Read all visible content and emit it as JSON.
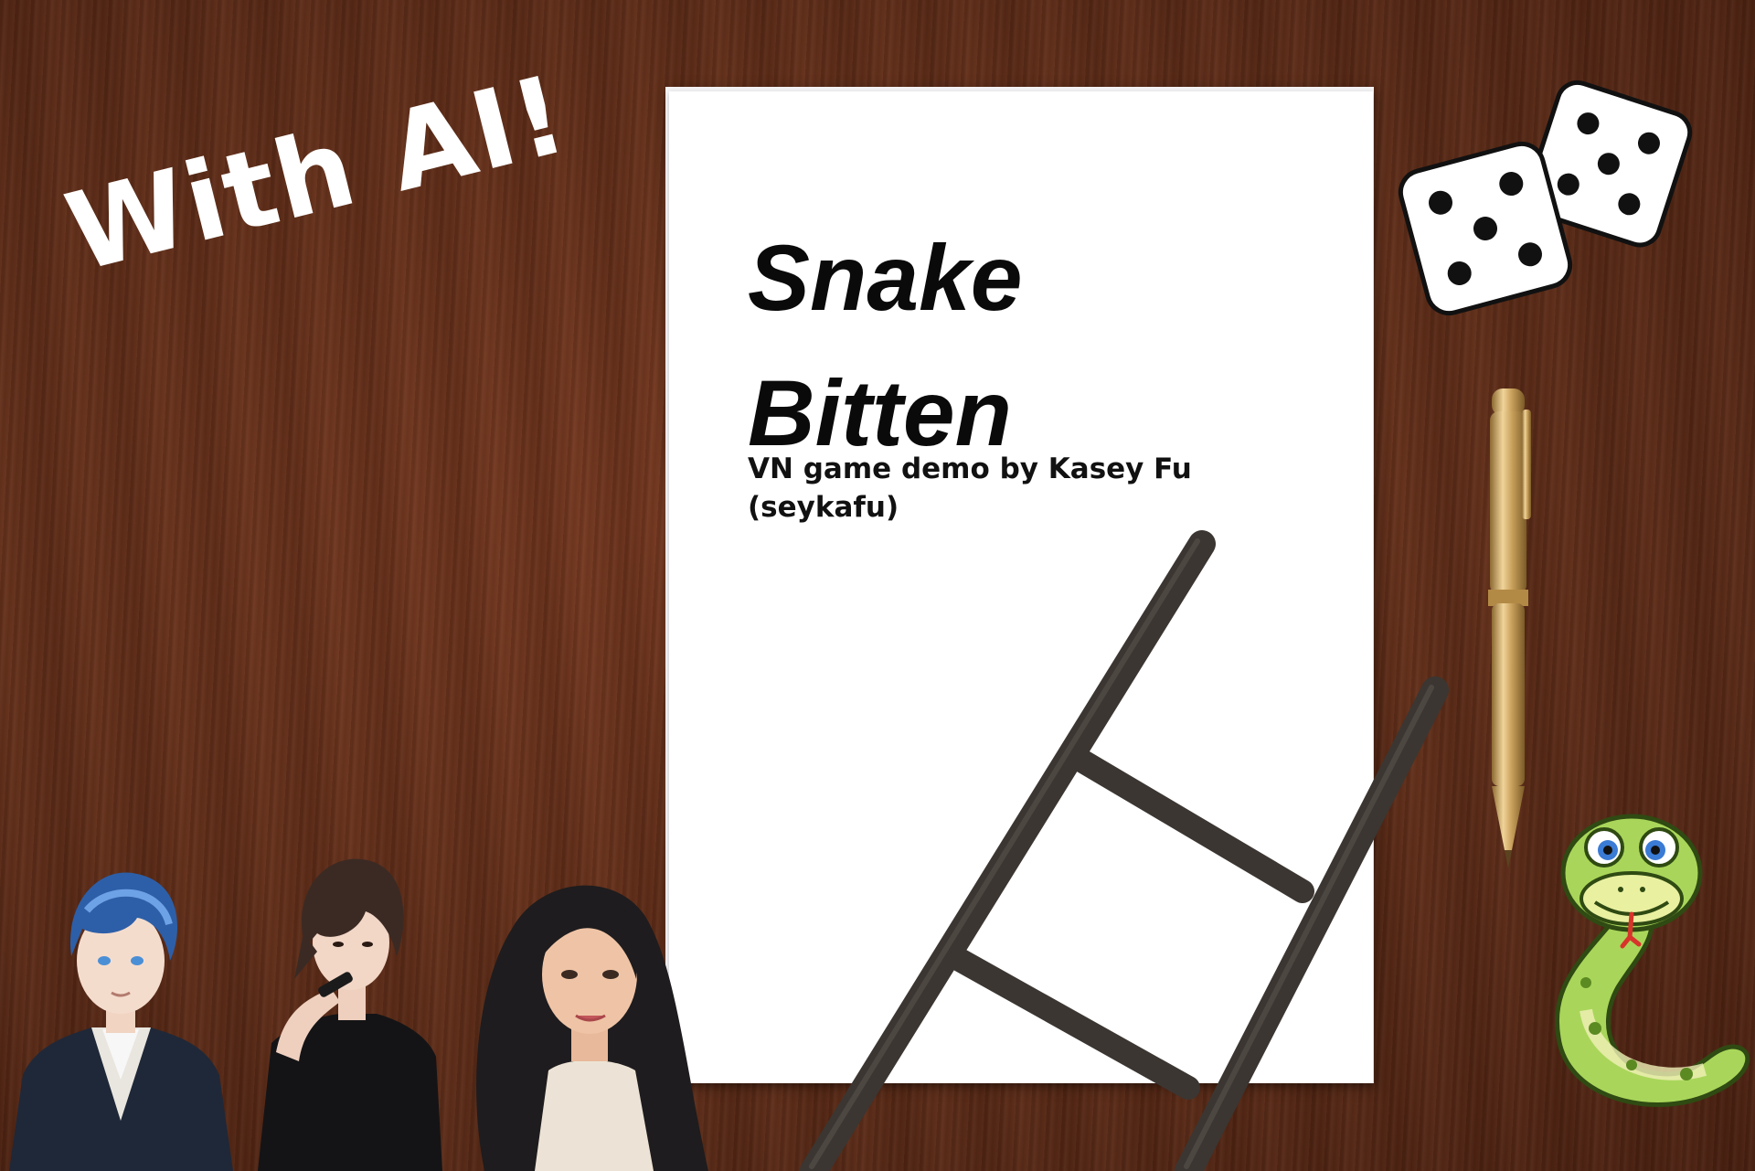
{
  "cover": {
    "tagline": "With AI!",
    "title_line1": "Snake",
    "title_line2": "Bitten",
    "subtitle": "VN game demo by Kasey Fu (seykafu)"
  },
  "decor": {
    "icons": [
      "dice-icon",
      "pen-icon",
      "ladder-icon",
      "snake-mascot-icon"
    ],
    "characters": [
      "character-blue-hair-man",
      "character-dark-hair-man",
      "character-dark-hair-woman"
    ]
  },
  "colors": {
    "desk": "#61301b",
    "paper": "#ffffff",
    "title_text": "#0a0a0a",
    "tagline_text": "#ffffff",
    "ladder": "#3b3632",
    "pen_gold": "#c9a15c",
    "snake_green": "#a9d65a"
  }
}
